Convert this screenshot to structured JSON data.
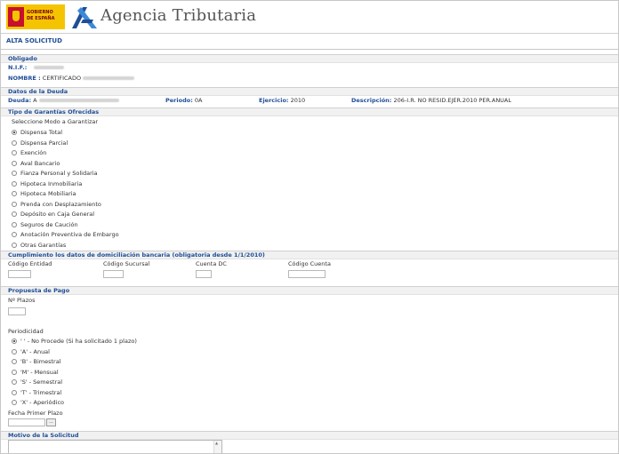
{
  "header": {
    "gov_logo_text": "GOBIERNO\nDE ESPAÑA",
    "title": "Agencia Tributaria"
  },
  "page_title": "ALTA SOLICITUD",
  "obligado": {
    "section": "Obligado",
    "nif_label": "N.I.F.:",
    "nombre_label": "NOMBRE :",
    "nombre_value": "CERTIFICADO"
  },
  "deuda": {
    "section": "Datos de la Deuda",
    "deuda_label": "Deuda:",
    "deuda_value": "A",
    "periodo_label": "Periodo:",
    "periodo_value": "0A",
    "ejercicio_label": "Ejercicio:",
    "ejercicio_value": "2010",
    "descripcion_label": "Descripción:",
    "descripcion_value": "206-I.R. NO RESID.EJER.2010 PER.ANUAL"
  },
  "garantias": {
    "section": "Tipo de Garantías Ofrecidas",
    "prompt": "Seleccione Modo a Garantizar",
    "options": [
      "Dispensa Total",
      "Dispensa Parcial",
      "Exención",
      "Aval Bancario",
      "Fianza Personal y Solidaria",
      "Hipoteca Inmobiliaria",
      "Hipoteca Mobiliaria",
      "Prenda con Desplazamiento",
      "Depósito en Caja General",
      "Seguros de Caución",
      "Anotación Preventiva de Embargo",
      "Otras Garantías"
    ],
    "selected_index": 0
  },
  "domiciliacion": {
    "section": "Cumplimiento los datos de domiciliación bancaria (obligatoria desde 1/1/2010)",
    "codigo_entidad": "Código Entidad",
    "codigo_sucursal": "Código Sucursal",
    "cuenta_dc": "Cuenta DC",
    "codigo_cuenta": "Código Cuenta"
  },
  "propuesta": {
    "section": "Propuesta de Pago",
    "plazos_label": "Nº Plazos",
    "periodicidad_label": "Periodicidad",
    "periodicidad_options": [
      "' ' - No Procede (Si ha solicitado 1 plazo)",
      "'A' - Anual",
      "'B' - Bimestral",
      "'M' - Mensual",
      "'S' - Semestral",
      "'T' - Trimestral",
      "'X' - Aperiódico"
    ],
    "periodicidad_selected": 0,
    "fecha_label": "Fecha Primer Plazo",
    "calendar_button": "..."
  },
  "motivo": {
    "section": "Motivo de la Solicitud"
  },
  "colors": {
    "accent": "#1f4e96",
    "logo_yellow": "#f5c400",
    "logo_red": "#c8102e"
  }
}
